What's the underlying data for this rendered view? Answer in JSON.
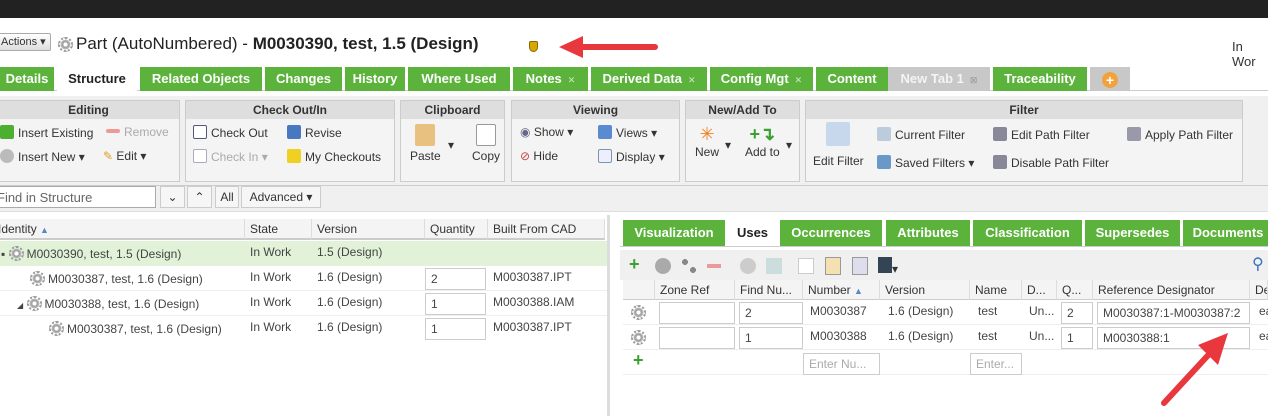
{
  "header": {
    "actions_label": "Actions",
    "title_prefix": "Part (AutoNumbered) - ",
    "title_bold": "M0030390, test, 1.5 (Design)",
    "state": "In Wor"
  },
  "tabs": [
    {
      "label": "Details"
    },
    {
      "label": "Structure",
      "active": true
    },
    {
      "label": "Related Objects"
    },
    {
      "label": "Changes"
    },
    {
      "label": "History"
    },
    {
      "label": "Where Used"
    },
    {
      "label": "Notes",
      "closable": true
    },
    {
      "label": "Derived Data",
      "closable": true
    },
    {
      "label": "Config Mgt",
      "closable": true
    },
    {
      "label": "Content"
    },
    {
      "label": "New Tab 1",
      "closable": true
    },
    {
      "label": "Traceability"
    }
  ],
  "toolbar": {
    "editing": {
      "title": "Editing",
      "insert_existing": "Insert Existing",
      "remove": "Remove",
      "insert_new": "Insert New",
      "edit": "Edit"
    },
    "checkout": {
      "title": "Check Out/In",
      "check_out": "Check Out",
      "revise": "Revise",
      "check_in": "Check In",
      "my_checkouts": "My Checkouts"
    },
    "clipboard": {
      "title": "Clipboard",
      "paste": "Paste",
      "copy": "Copy"
    },
    "viewing": {
      "title": "Viewing",
      "show": "Show",
      "views": "Views",
      "hide": "Hide",
      "display": "Display"
    },
    "newadd": {
      "title": "New/Add To",
      "new": "New",
      "add_to": "Add to"
    },
    "filter": {
      "title": "Filter",
      "edit_filter": "Edit Filter",
      "current_filter": "Current Filter",
      "saved_filters": "Saved Filters",
      "edit_path_filter": "Edit Path Filter",
      "disable_path_filter": "Disable Path Filter",
      "apply_path_filter": "Apply Path Filter"
    }
  },
  "search": {
    "placeholder": "Find in Structure",
    "all": "All",
    "advanced": "Advanced"
  },
  "structure": {
    "columns": [
      "Identity",
      "State",
      "Version",
      "Quantity",
      "Built From CAD"
    ],
    "rows": [
      {
        "identity": "M0030390, test, 1.5 (Design)",
        "state": "In Work",
        "version": "1.5 (Design)",
        "quantity": "",
        "cad": ""
      },
      {
        "identity": "M0030387, test, 1.6 (Design)",
        "state": "In Work",
        "version": "1.6 (Design)",
        "quantity": "2",
        "cad": "M0030387.IPT"
      },
      {
        "identity": "M0030388, test, 1.6 (Design)",
        "state": "In Work",
        "version": "1.6 (Design)",
        "quantity": "1",
        "cad": "M0030388.IAM"
      },
      {
        "identity": "M0030387, test, 1.6 (Design)",
        "state": "In Work",
        "version": "1.6 (Design)",
        "quantity": "1",
        "cad": "M0030387.IPT"
      }
    ]
  },
  "right_tabs": [
    {
      "label": "Visualization"
    },
    {
      "label": "Uses",
      "active": true
    },
    {
      "label": "Occurrences"
    },
    {
      "label": "Attributes"
    },
    {
      "label": "Classification"
    },
    {
      "label": "Supersedes"
    },
    {
      "label": "Documents"
    }
  ],
  "uses": {
    "columns": [
      "Zone Ref",
      "Find Nu...",
      "Number",
      "Version",
      "Name",
      "D...",
      "Q...",
      "Reference Designator",
      "De"
    ],
    "rows": [
      {
        "zone": "",
        "find": "2",
        "number": "M0030387",
        "version": "1.6 (Design)",
        "name": "test",
        "d": "Un...",
        "q": "2",
        "refdes": "M0030387:1-M0030387:2",
        "de": "ea"
      },
      {
        "zone": "",
        "find": "1",
        "number": "M0030388",
        "version": "1.6 (Design)",
        "name": "test",
        "d": "Un...",
        "q": "1",
        "refdes": "M0030388:1",
        "de": "ea"
      }
    ],
    "number_placeholder": "Enter Nu...",
    "name_placeholder": "Enter..."
  },
  "colors": {
    "tab_green": "#5cb33b",
    "arrow_red": "#e8383d",
    "selected_row": "#e1f2d9"
  }
}
